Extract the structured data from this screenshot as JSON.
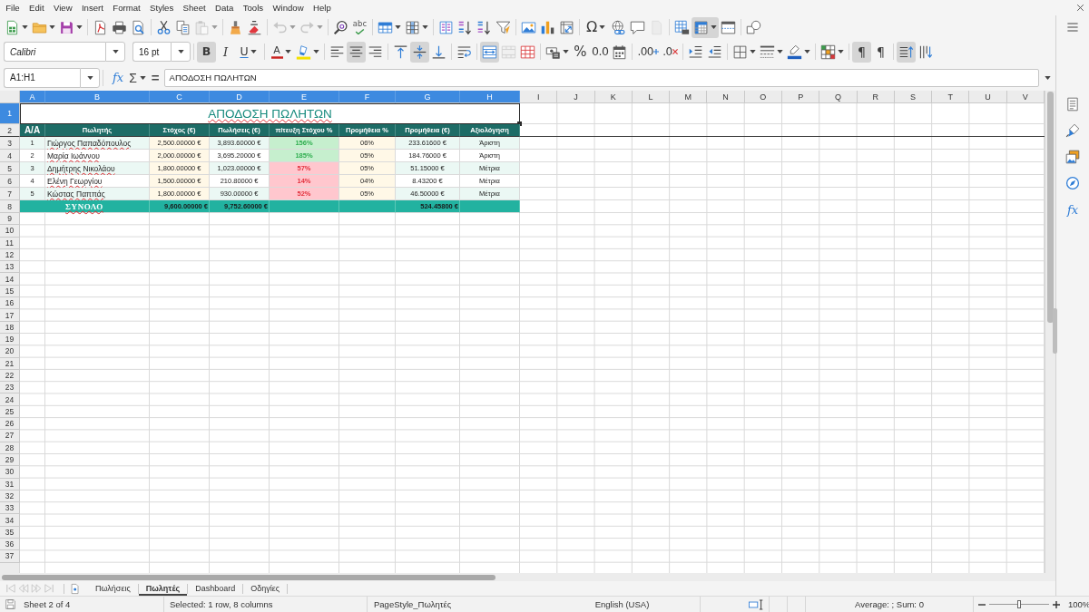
{
  "menu_bar": [
    "File",
    "Edit",
    "View",
    "Insert",
    "Format",
    "Styles",
    "Sheet",
    "Data",
    "Tools",
    "Window",
    "Help"
  ],
  "standard_toolbar": [
    {
      "pressed": false,
      "disabled": false
    },
    {
      "pressed": false,
      "disabled": false
    },
    {
      "pressed": false,
      "disabled": false
    },
    {
      "pressed": false,
      "disabled": false
    },
    {
      "pressed": false,
      "disabled": false
    },
    {
      "pressed": false,
      "disabled": false
    },
    {
      "pressed": false,
      "disabled": false
    },
    {
      "pressed": false,
      "disabled": false
    },
    {
      "pressed": false,
      "disabled": true
    },
    {
      "pressed": false,
      "disabled": false
    },
    {
      "pressed": false,
      "disabled": false
    },
    {
      "pressed": false,
      "disabled": true
    },
    {
      "pressed": false,
      "disabled": true
    },
    {
      "pressed": false,
      "disabled": false
    },
    {
      "glyph": "abc",
      "pressed": false,
      "disabled": false
    },
    {
      "pressed": false,
      "disabled": false
    },
    {
      "pressed": false,
      "disabled": false
    },
    {
      "pressed": false,
      "disabled": false
    },
    {
      "pressed": false,
      "disabled": false
    },
    {
      "pressed": false,
      "disabled": false
    },
    {
      "pressed": false,
      "disabled": false
    },
    {
      "pressed": false,
      "disabled": false
    },
    {
      "pressed": false,
      "disabled": false
    },
    {
      "pressed": false,
      "disabled": false
    },
    {
      "glyph": "Ω",
      "pressed": false,
      "disabled": false
    },
    {
      "pressed": false,
      "disabled": false
    },
    {
      "pressed": false,
      "disabled": false
    },
    {
      "pressed": false,
      "disabled": true
    },
    {
      "pressed": false,
      "disabled": false
    },
    {
      "pressed": true,
      "disabled": false
    },
    {
      "pressed": false,
      "disabled": false
    },
    {
      "pressed": false,
      "disabled": false
    }
  ],
  "formatting_toolbar": {
    "font_name": "Calibri",
    "font_size": "16 pt",
    "buttons": [
      {
        "glyph": "B",
        "pressed": true,
        "disabled": false
      },
      {
        "glyph": "I",
        "pressed": false,
        "disabled": false
      },
      {
        "glyph": "U",
        "pressed": false,
        "disabled": false
      },
      {
        "glyph": "A",
        "pressed": false,
        "disabled": false
      },
      {
        "pressed": false,
        "disabled": false
      },
      {
        "pressed": false,
        "disabled": false
      },
      {
        "pressed": true,
        "disabled": false
      },
      {
        "pressed": false,
        "disabled": false
      },
      {
        "pressed": false,
        "disabled": false
      },
      {
        "pressed": true,
        "disabled": false
      },
      {
        "pressed": false,
        "disabled": false
      },
      {
        "pressed": false,
        "disabled": false
      },
      {
        "pressed": true,
        "disabled": false
      },
      {
        "pressed": false,
        "disabled": true
      },
      {
        "pressed": false,
        "disabled": false
      },
      {
        "pressed": false,
        "disabled": false
      },
      {
        "glyph": "%",
        "pressed": false,
        "disabled": false
      },
      {
        "glyph": "0.0",
        "pressed": false,
        "disabled": false
      },
      {
        "pressed": false,
        "disabled": false
      },
      {
        "glyph": ".00",
        "pressed": false,
        "disabled": false
      },
      {
        "glyph": ".0",
        "pressed": false,
        "disabled": false
      },
      {
        "pressed": false,
        "disabled": false
      },
      {
        "pressed": false,
        "disabled": false
      },
      {
        "pressed": false,
        "disabled": false
      },
      {
        "pressed": false,
        "disabled": false
      },
      {
        "pressed": false,
        "disabled": false
      },
      {
        "pressed": false,
        "disabled": false
      },
      {
        "glyph": "¶",
        "pressed": true,
        "disabled": false
      },
      {
        "glyph": "¶",
        "pressed": false,
        "disabled": false
      },
      {
        "pressed": true,
        "disabled": false
      },
      {
        "pressed": false,
        "disabled": false
      }
    ]
  },
  "formula_bar": {
    "name_box": "A1:H1",
    "function_wizard": "fx",
    "sum": "Σ",
    "formula_sign": "=",
    "formula": "ΑΠΟΔΟΣΗ ΠΩΛΗΤΩΝ"
  },
  "sheet": {
    "column_headers": [
      {
        "label": "A",
        "selected": true
      },
      {
        "label": "B",
        "selected": true
      },
      {
        "label": "C",
        "selected": true
      },
      {
        "label": "D",
        "selected": true
      },
      {
        "label": "E",
        "selected": true
      },
      {
        "label": "F",
        "selected": true
      },
      {
        "label": "G",
        "selected": true
      },
      {
        "label": "H",
        "selected": true
      },
      {
        "label": "I",
        "selected": false
      },
      {
        "label": "J",
        "selected": false
      },
      {
        "label": "K",
        "selected": false
      },
      {
        "label": "L",
        "selected": false
      },
      {
        "label": "M",
        "selected": false
      },
      {
        "label": "N",
        "selected": false
      },
      {
        "label": "O",
        "selected": false
      },
      {
        "label": "P",
        "selected": false
      },
      {
        "label": "Q",
        "selected": false
      },
      {
        "label": "R",
        "selected": false
      },
      {
        "label": "S",
        "selected": false
      },
      {
        "label": "T",
        "selected": false
      },
      {
        "label": "U",
        "selected": false
      },
      {
        "label": "V",
        "selected": false
      }
    ],
    "row_headers": [
      {
        "label": "1",
        "selected": true
      },
      {
        "label": "2",
        "selected": false
      },
      {
        "label": "3",
        "selected": false
      },
      {
        "label": "4",
        "selected": false
      },
      {
        "label": "5",
        "selected": false
      },
      {
        "label": "6",
        "selected": false
      },
      {
        "label": "7",
        "selected": false
      },
      {
        "label": "8",
        "selected": false
      },
      {
        "label": "9",
        "selected": false
      },
      {
        "label": "10",
        "selected": false
      },
      {
        "label": "11",
        "selected": false
      },
      {
        "label": "12",
        "selected": false
      },
      {
        "label": "13",
        "selected": false
      },
      {
        "label": "14",
        "selected": false
      },
      {
        "label": "15",
        "selected": false
      },
      {
        "label": "16",
        "selected": false
      },
      {
        "label": "17",
        "selected": false
      },
      {
        "label": "18",
        "selected": false
      },
      {
        "label": "19",
        "selected": false
      },
      {
        "label": "20",
        "selected": false
      },
      {
        "label": "21",
        "selected": false
      },
      {
        "label": "22",
        "selected": false
      },
      {
        "label": "23",
        "selected": false
      },
      {
        "label": "24",
        "selected": false
      },
      {
        "label": "25",
        "selected": false
      },
      {
        "label": "26",
        "selected": false
      },
      {
        "label": "27",
        "selected": false
      },
      {
        "label": "28",
        "selected": false
      },
      {
        "label": "29",
        "selected": false
      },
      {
        "label": "30",
        "selected": false
      },
      {
        "label": "31",
        "selected": false
      },
      {
        "label": "32",
        "selected": false
      },
      {
        "label": "33",
        "selected": false
      },
      {
        "label": "34",
        "selected": false
      },
      {
        "label": "35",
        "selected": false
      },
      {
        "label": "36",
        "selected": false
      },
      {
        "label": "37",
        "selected": false
      }
    ],
    "title": {
      "text": "ΑΠΟΔΟΣΗ ΠΩΛΗΤΩΝ",
      "spell_flagged": true
    },
    "header_row": [
      "Α/Α",
      "Πωλητής",
      "Στόχος (€)",
      "Πωλήσεις (€)",
      "πίτευξη Στόχου %",
      "Προμήθεια %",
      "Προμήθεια (€)",
      "Αξιολόγηση"
    ],
    "rows": [
      {
        "number": "1",
        "name": "Γιώργος Παπαδόπουλος",
        "spell_flagged": true,
        "target": "2,500.00000 €",
        "sales": "3,893.60000 €",
        "achievement": "156%",
        "target_met": true,
        "commission_rate": "06%",
        "commission": "233.61600 €",
        "rating": "Άριστη"
      },
      {
        "number": "2",
        "name": "Μαρία Ιωάννου",
        "spell_flagged": true,
        "target": "2,000.00000 €",
        "sales": "3,695.20000 €",
        "achievement": "185%",
        "target_met": true,
        "commission_rate": "05%",
        "commission": "184.76000 €",
        "rating": "Άριστη"
      },
      {
        "number": "3",
        "name": "Δημήτρης Νικολάου",
        "spell_flagged": true,
        "target": "1,800.00000 €",
        "sales": "1,023.00000 €",
        "achievement": "57%",
        "target_met": false,
        "commission_rate": "05%",
        "commission": "51.15000 €",
        "rating": "Μέτρια"
      },
      {
        "number": "4",
        "name": "Ελένη Γεωργίου",
        "spell_flagged": true,
        "target": "1,500.00000 €",
        "sales": "210.80000 €",
        "achievement": "14%",
        "target_met": false,
        "commission_rate": "04%",
        "commission": "8.43200 €",
        "rating": "Μέτρια"
      },
      {
        "number": "5",
        "name": "Κώστας Παππάς",
        "spell_flagged": true,
        "target": "1,800.00000 €",
        "sales": "930.00000 €",
        "achievement": "52%",
        "target_met": false,
        "commission_rate": "05%",
        "commission": "46.50000 €",
        "rating": "Μέτρια"
      }
    ],
    "totals": {
      "label": "ΣΥΝΟΛΟ",
      "spell_flagged": true,
      "target": "9,600.00000 €",
      "sales": "9,752.60000 €",
      "commission": "524.45800 €"
    }
  },
  "sheet_tabs": {
    "navigation_disabled": true,
    "tabs": [
      {
        "label": "Πωλήσεις",
        "selected": false
      },
      {
        "label": "Πωλητές",
        "selected": true
      },
      {
        "label": "Dashboard",
        "selected": false
      },
      {
        "label": "Οδηγίες",
        "selected": false
      }
    ]
  },
  "sidebar": {
    "functions": "fx"
  },
  "status_bar": {
    "sheet_position": "Sheet 2 of 4",
    "selection": "Selected: 1 row, 8 columns",
    "page_style": "PageStyle_Πωλητές",
    "language": "English (USA)",
    "summary": "Average: ; Sum: 0",
    "zoom_slider": {
      "level": 0.5
    },
    "zoom": "100%"
  }
}
